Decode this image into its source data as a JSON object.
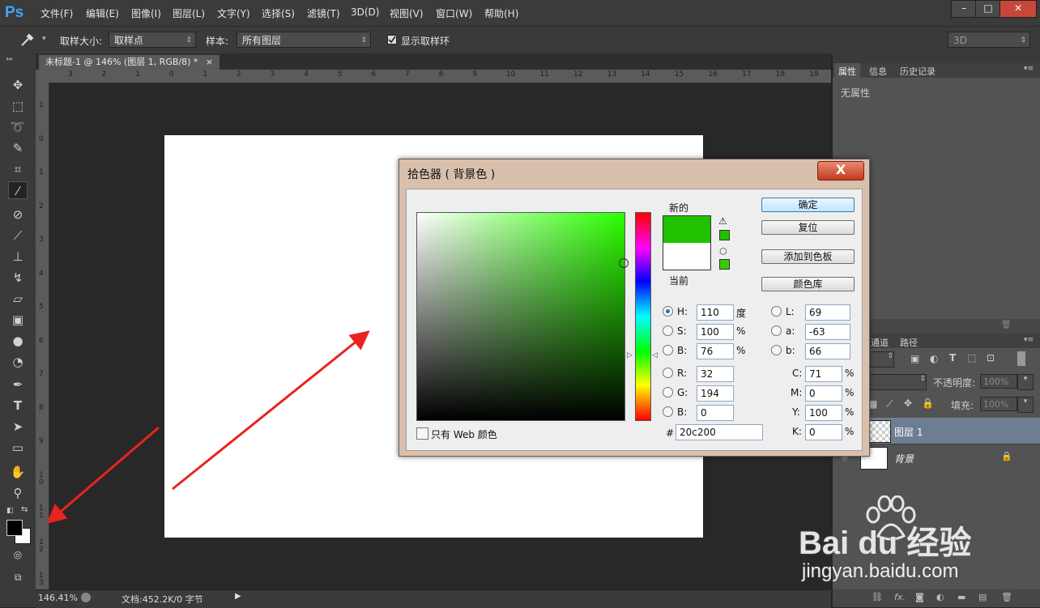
{
  "app": {
    "logo": "Ps",
    "menu": [
      "文件(F)",
      "编辑(E)",
      "图像(I)",
      "图层(L)",
      "文字(Y)",
      "选择(S)",
      "滤镜(T)",
      "3D(D)",
      "视图(V)",
      "窗口(W)",
      "帮助(H)"
    ],
    "window_buttons": {
      "minimize": "–",
      "maximize": "□",
      "close": "✕"
    }
  },
  "options": {
    "sample_size_label": "取样大小:",
    "sample_size_value": "取样点",
    "sample_label": "样本:",
    "sample_value": "所有图层",
    "show_ring_label": "显示取样环",
    "workspace_value": "3D"
  },
  "document": {
    "tab_title": "未标题-1 @ 146% (图层 1, RGB/8) *",
    "tab_close": "×",
    "ruler_top_labels": [
      "3",
      "2",
      "1",
      "0",
      "1",
      "2",
      "3",
      "4",
      "5",
      "6",
      "7",
      "8",
      "9",
      "10",
      "11",
      "12",
      "13",
      "14",
      "15",
      "16",
      "17",
      "18",
      "19"
    ],
    "ruler_left_labels": [
      "1",
      "0",
      "1",
      "2",
      "3",
      "4",
      "5",
      "6",
      "7",
      "8",
      "9",
      "1 0",
      "1 1",
      "1 2",
      "1 3"
    ]
  },
  "status": {
    "zoom": "146.41%",
    "doc_info": "文档:452.2K/0 字节"
  },
  "panels": {
    "tabs": [
      "属性",
      "信息",
      "历史记录"
    ],
    "properties_empty": "无属性",
    "layer_tabs": [
      "通道",
      "路径"
    ],
    "opacity_label": "不透明度:",
    "opacity_value": "100%",
    "fill_label": "填充:",
    "fill_value": "100%",
    "layers": [
      {
        "name": "图层 1"
      },
      {
        "name": "背景"
      }
    ]
  },
  "color_picker": {
    "title": "拾色器 ( 背景色 )",
    "close": "X",
    "new_label": "新的",
    "current_label": "当前",
    "new_color": "#20c200",
    "current_color": "#ffffff",
    "buttons": {
      "ok": "确定",
      "reset": "复位",
      "add_to_swatches": "添加到色板",
      "color_libraries": "颜色库"
    },
    "web_only_label": "只有 Web 颜色",
    "hsb": {
      "H": "110",
      "S": "100",
      "B": "76",
      "h_unit": "度",
      "s_unit": "%",
      "b_unit": "%"
    },
    "rgb": {
      "R": "32",
      "G": "194",
      "B": "0"
    },
    "lab": {
      "L": "69",
      "a": "-63",
      "b": "66"
    },
    "cmyk": {
      "C": "71",
      "M": "0",
      "Y": "100",
      "K": "0",
      "unit": "%"
    },
    "hex": "20c200"
  },
  "watermark": {
    "brand": "Bai du 经验",
    "url": "jingyan.baidu.com"
  }
}
